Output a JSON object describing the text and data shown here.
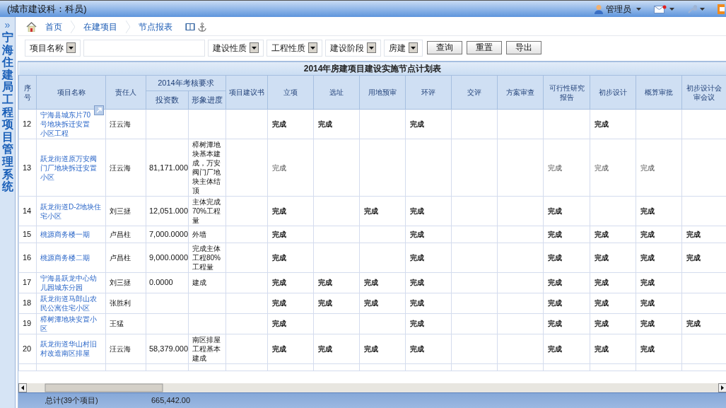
{
  "header": {
    "title": "(城市建设科：科员)",
    "user": "管理员"
  },
  "sidebar": {
    "toggle": "»",
    "title": "宁海住建局工程项目管理系统"
  },
  "breadcrumb": [
    {
      "label": "首页"
    },
    {
      "label": "在建项目"
    },
    {
      "label": "节点报表"
    }
  ],
  "filters": [
    {
      "kind": "select",
      "label": "项目名称"
    },
    {
      "kind": "input"
    },
    {
      "kind": "select",
      "label": "建设性质"
    },
    {
      "kind": "select",
      "label": "工程性质"
    },
    {
      "kind": "select",
      "label": "建设阶段"
    },
    {
      "kind": "select",
      "label": "房建"
    }
  ],
  "buttons": [
    "查询",
    "重置",
    "导出"
  ],
  "table": {
    "title": "2014年房建项目建设实施节点计划表",
    "columns": [
      {
        "label": "序号"
      },
      {
        "label": "项目名称"
      },
      {
        "label": "责任人"
      },
      {
        "label": "2014年考核要求",
        "children": [
          {
            "label": "投资数"
          },
          {
            "label": "形象进度"
          }
        ]
      },
      {
        "label": "项目建议书"
      },
      {
        "label": "立项"
      },
      {
        "label": "选址"
      },
      {
        "label": "用地预审"
      },
      {
        "label": "环评"
      },
      {
        "label": "交评"
      },
      {
        "label": "方案审查"
      },
      {
        "label": "可行性研究报告"
      },
      {
        "label": "初步设计"
      },
      {
        "label": "概算审批"
      },
      {
        "label": "初步设计会审会议"
      }
    ],
    "rows": [
      {
        "no": "12",
        "name": "宁海县城东片70号地块拆迁安置小区工程",
        "owner": "汪云海",
        "bold": true,
        "float_icon": true,
        "milestones": {
          "project_approval": "完成",
          "site_selection": "完成",
          "environmental_review": "完成",
          "preliminary_design": "完成"
        }
      },
      {
        "no": "13",
        "name": "跃龙街道原万安阀门厂地块拆迁安置小区",
        "owner": "汪云海",
        "investment": "81,171.000",
        "progress": "樟树潭地块基本建成，万安阀门厂地块主体结顶",
        "bold": false,
        "milestones": {
          "project_approval": "完成",
          "feasibility_report": "完成",
          "preliminary_design": "完成",
          "budget_approval": "完成"
        }
      },
      {
        "no": "14",
        "name": "跃龙街道D-2地块住宅小区",
        "owner": "刘三拯",
        "investment": "12,051.000",
        "progress": "主体完成70%工程量",
        "bold": true,
        "milestones": {
          "project_approval": "完成",
          "land_pre_review": "完成",
          "environmental_review": "完成",
          "feasibility_report": "完成",
          "budget_approval": "完成"
        }
      },
      {
        "no": "15",
        "name": "桃源商务楼一期",
        "owner": "卢昌柱",
        "investment": "7,000.0000",
        "progress": "外墙",
        "bold": true,
        "milestones": {
          "project_approval": "完成",
          "environmental_review": "完成",
          "feasibility_report": "完成",
          "preliminary_design": "完成",
          "budget_approval": "完成",
          "design_review_meeting": "完成"
        }
      },
      {
        "no": "16",
        "name": "桃源商务楼二期",
        "owner": "卢昌柱",
        "investment": "9,000.0000",
        "progress": "完成主体工程80%工程量",
        "bold": true,
        "milestones": {
          "project_approval": "完成",
          "environmental_review": "完成",
          "feasibility_report": "完成",
          "preliminary_design": "完成",
          "budget_approval": "完成",
          "design_review_meeting": "完成"
        }
      },
      {
        "no": "17",
        "name": "宁海县跃龙中心幼儿园城东分园",
        "owner": "刘三拯",
        "investment": "0.0000",
        "progress": "建成",
        "bold": true,
        "milestones": {
          "project_approval": "完成",
          "site_selection": "完成",
          "land_pre_review": "完成",
          "environmental_review": "完成",
          "feasibility_report": "完成",
          "preliminary_design": "完成",
          "budget_approval": "完成"
        }
      },
      {
        "no": "18",
        "name": "跃龙街道马郎山农民公寓住宅小区",
        "owner": "张胜利",
        "bold": true,
        "milestones": {
          "project_approval": "完成",
          "site_selection": "完成",
          "land_pre_review": "完成",
          "environmental_review": "完成",
          "feasibility_report": "完成",
          "preliminary_design": "完成",
          "budget_approval": "完成"
        }
      },
      {
        "no": "19",
        "name": "樟树潭地块安置小区",
        "owner": "王猛",
        "bold": true,
        "milestones": {
          "project_approval": "完成",
          "environmental_review": "完成",
          "feasibility_report": "完成",
          "preliminary_design": "完成",
          "budget_approval": "完成",
          "design_review_meeting": "完成"
        }
      },
      {
        "no": "20",
        "name": "跃龙街道华山村旧村改造南区排屋",
        "owner": "汪云海",
        "investment": "58,379.000",
        "progress": "南区排屋工程基本建成",
        "bold": true,
        "milestones": {
          "project_approval": "完成",
          "site_selection": "完成",
          "land_pre_review": "完成",
          "environmental_review": "完成",
          "feasibility_report": "完成",
          "preliminary_design": "完成",
          "budget_approval": "完成"
        }
      }
    ]
  },
  "footer": {
    "total_label": "总计(39个项目)",
    "total_value": "665,442.00"
  }
}
